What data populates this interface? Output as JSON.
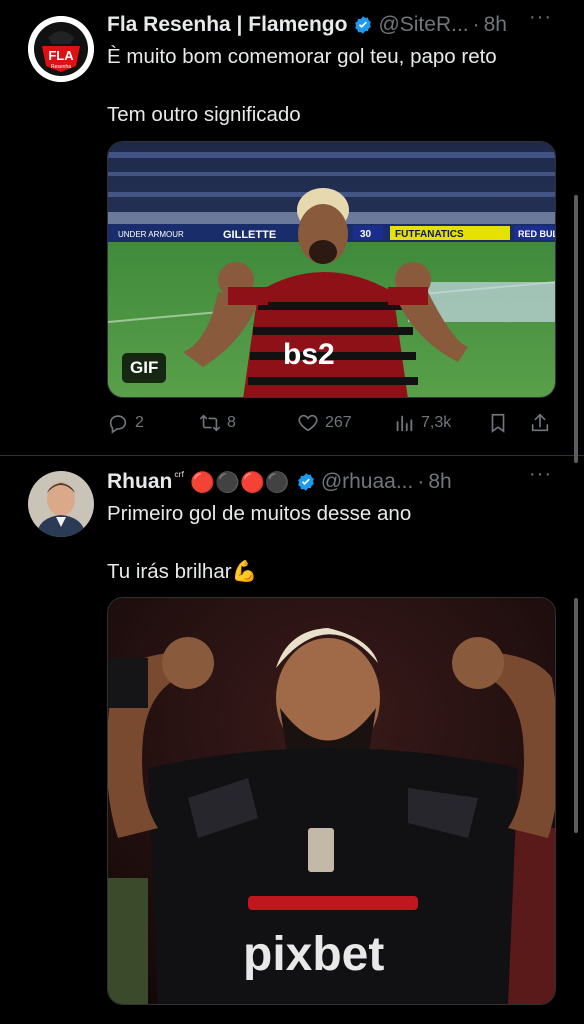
{
  "tweet1": {
    "author_name": "Fla Resenha | Flamengo",
    "handle": "@SiteR...",
    "time": "8h",
    "more": "···",
    "text_line1": "È muito bom comemorar gol teu, papo reto",
    "text_line2": "Tem outro significado",
    "media_badge": "GIF",
    "avatar_text": "FLA",
    "avatar_subtext": "Resenha",
    "media_jersey_text": "bs2",
    "media_sponsor": "GILLETTE",
    "media_board1": "FUTFANATICS",
    "media_board2": "RED BULL",
    "media_board3": "UNDER ARMOUR",
    "media_board4": "30",
    "replies": "2",
    "retweets": "8",
    "likes": "267",
    "views": "7,3k"
  },
  "tweet2": {
    "author_name": "Rhuan",
    "name_suffix": "ᶜʳᶠ",
    "emoji": "🔴⚫🔴⚫",
    "handle": "@rhuaa...",
    "time": "8h",
    "more": "···",
    "text_line1": "Primeiro gol de muitos desse ano",
    "text_line2": "Tu irás brilhar💪",
    "media_jersey_text": "pixbet"
  },
  "colors": {
    "background": "#000000",
    "text_primary": "#e7e9ea",
    "text_secondary": "#71767b",
    "verified": "#1d9bf0",
    "divider": "#2f3336"
  },
  "icons": {
    "reply": "reply-icon",
    "retweet": "retweet-icon",
    "like": "heart-icon",
    "views": "views-chart-icon",
    "bookmark": "bookmark-icon",
    "share": "share-icon",
    "verified": "verified-badge-icon",
    "more": "more-icon"
  }
}
